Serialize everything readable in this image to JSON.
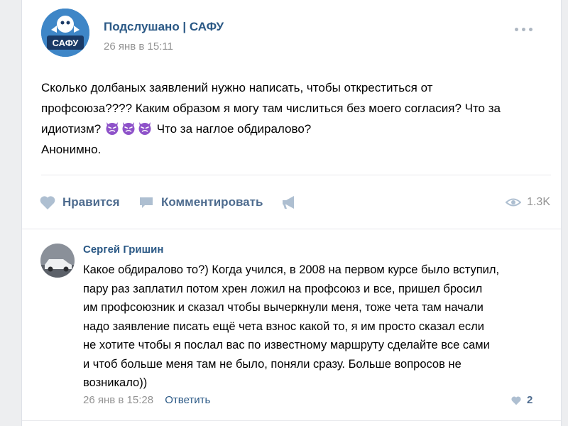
{
  "post": {
    "group_name": "Подслушано | САФУ",
    "avatar_text": "САФУ",
    "time": "26 янв в 15:11",
    "line1": "Сколько долбаных заявлений нужно написать, чтобы откреститься от",
    "line2": "профсоюза???? Каким образом я могу там числиться без моего согласия? Что за",
    "line3_before": "идиотизм?",
    "line3_after": "Что за наглое обдиралово?",
    "line4": "Анонимно.",
    "emoji_name": "angry-devil-emoji",
    "actions": {
      "like_label": "Нравится",
      "comment_label": "Комментировать",
      "views": "1.3K"
    }
  },
  "comment": {
    "author": "Сергей Гришин",
    "lines": [
      "Какое обдиралово то?) Когда учился, в 2008 на первом курсе было вступил,",
      "пару раз заплатил потом хрен ложил на профсоюз и все, пришел бросил",
      "им профсоюзник и сказал чтобы вычеркнули меня, тоже чета там начали",
      "надо заявление писать ещё чета взнос какой то, я им просто сказал если",
      "не хотите чтобы я послал вас по известному маршруту сделайте все сами",
      "и чтоб больше меня там не было, поняли сразу. Больше вопросов не",
      "возникало))"
    ],
    "time": "26 янв в 15:28",
    "reply_label": "Ответить",
    "likes": "2"
  },
  "colors": {
    "link": "#2a5885",
    "action": "#4e6c8f",
    "meta": "#939393",
    "emoji": "#8e52c9"
  }
}
